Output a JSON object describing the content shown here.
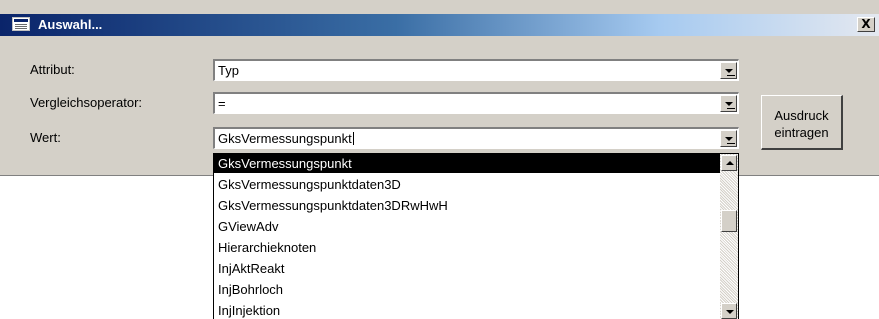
{
  "window": {
    "title": "Auswahl...",
    "close_symbol": "X"
  },
  "form": {
    "attribut_label": "Attribut:",
    "attribut_value": "Typ",
    "operator_label": "Vergleichsoperator:",
    "operator_value": "=",
    "wert_label": "Wert:",
    "wert_value": "GksVermessungspunkt"
  },
  "button": {
    "line1": "Ausdruck",
    "line2": "eintragen"
  },
  "dropdown": {
    "items": [
      "GksVermessungspunkt",
      "GksVermessungspunktdaten3D",
      "GksVermessungspunktdaten3DRwHwH",
      "GViewAdv",
      "Hierarchieknoten",
      "InjAktReakt",
      "InjBohrloch",
      "InjInjektion"
    ],
    "selected_index": 0
  },
  "icons": [
    "form-icon",
    "close-icon",
    "chevron-down-icon",
    "scroll-up-icon",
    "scroll-down-icon"
  ],
  "colors": {
    "dialog_bg": "#d4d0c8",
    "title_start": "#0a246a",
    "selection": "#000000"
  }
}
